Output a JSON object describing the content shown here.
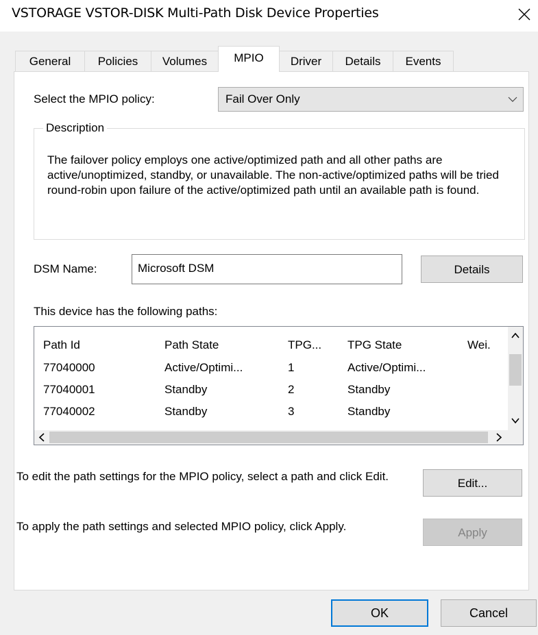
{
  "window": {
    "title": "VSTORAGE VSTOR-DISK  Multi-Path Disk Device Properties"
  },
  "tabs": [
    {
      "label": "General"
    },
    {
      "label": "Policies"
    },
    {
      "label": "Volumes"
    },
    {
      "label": "MPIO"
    },
    {
      "label": "Driver"
    },
    {
      "label": "Details"
    },
    {
      "label": "Events"
    }
  ],
  "active_tab": "MPIO",
  "mpio": {
    "policy_label": "Select the MPIO policy:",
    "policy_value": "Fail Over Only",
    "description_title": "Description",
    "description_text": "The failover policy employs one active/optimized path and all other paths are active/unoptimized, standby, or unavailable.  The non-active/optimized paths will be tried round-robin upon failure of the active/optimized path until an available path is found.",
    "dsm_label": "DSM Name:",
    "dsm_value": "Microsoft DSM",
    "details_button": "Details",
    "paths_label": "This device has the following paths:",
    "columns": [
      "Path Id",
      "Path State",
      "TPG...",
      "TPG State",
      "Wei."
    ],
    "rows": [
      [
        "77040000",
        "Active/Optimi...",
        "1",
        "Active/Optimi...",
        ""
      ],
      [
        "77040001",
        "Standby",
        "2",
        "Standby",
        ""
      ],
      [
        "77040002",
        "Standby",
        "3",
        "Standby",
        ""
      ]
    ],
    "edit_text": "To edit the path settings for the MPIO policy, select a path and click Edit.",
    "edit_button": "Edit...",
    "apply_text": "To apply the path settings and selected MPIO policy, click Apply.",
    "apply_button": "Apply"
  },
  "footer": {
    "ok": "OK",
    "cancel": "Cancel"
  },
  "icons": {
    "close": "close-icon",
    "dropdown": "chevron-down-icon",
    "scroll_up": "scroll-up-arrow-icon",
    "scroll_down": "scroll-down-arrow-icon",
    "scroll_left": "scroll-left-arrow-icon",
    "scroll_right": "scroll-right-arrow-icon"
  },
  "colors": {
    "accent": "#0078d7",
    "panel": "#ffffff",
    "dialog_bg": "#f0f0f0"
  }
}
